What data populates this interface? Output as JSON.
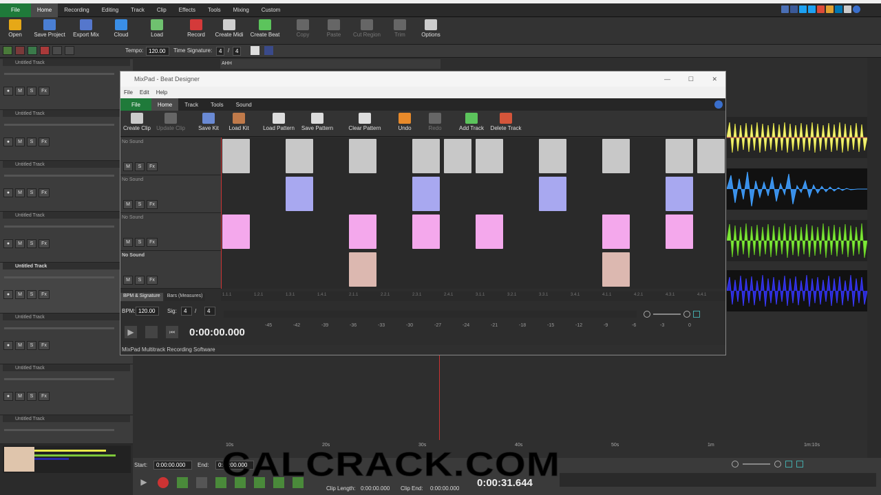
{
  "app_tabs": [
    "File",
    "Home",
    "Recording",
    "Editing",
    "Track",
    "Clip",
    "Effects",
    "Tools",
    "Mixing",
    "Custom"
  ],
  "ribbon": [
    {
      "label": "Open",
      "color": "#e6a817"
    },
    {
      "label": "Save Project",
      "color": "#4a7fd4"
    },
    {
      "label": "Export Mix",
      "color": "#5577cc"
    },
    {
      "label": "Cloud",
      "color": "#3a8ee6"
    },
    {
      "label": "Load",
      "color": "#6fc16f"
    },
    {
      "label": "Record",
      "color": "#d43a3a"
    },
    {
      "label": "Create Midi",
      "color": "#cfcfcf"
    },
    {
      "label": "Create Beat",
      "color": "#5cc45c"
    },
    {
      "label": "Copy",
      "color": "#777"
    },
    {
      "label": "Paste",
      "color": "#777"
    },
    {
      "label": "Cut Region",
      "color": "#777"
    },
    {
      "label": "Trim",
      "color": "#777"
    },
    {
      "label": "Options",
      "color": "#cccccc"
    }
  ],
  "toolrow": {
    "tempo_label": "Tempo:",
    "tempo": "120.00",
    "sig_label": "Time Signature:",
    "sig_top": "4",
    "sig_sep": "/",
    "sig_bottom": "4"
  },
  "tracks": [
    "Untitled Track",
    "Untitled Track",
    "Untitled Track",
    "Untitled Track",
    "Untitled Track",
    "Untitled Track",
    "Untitled Track",
    "Untitled Track"
  ],
  "track_buttons": [
    "M",
    "S",
    "Fx"
  ],
  "clip_label": "AHH",
  "dialog": {
    "title": "MixPad - Beat Designer",
    "menu": [
      "File",
      "Edit",
      "Help"
    ],
    "tabs": [
      "File",
      "Home",
      "Track",
      "Tools",
      "Sound"
    ],
    "ribbon": [
      "Create Clip",
      "Update Clip",
      "Save Kit",
      "Load Kit",
      "Load Pattern",
      "Save Pattern",
      "Clear Pattern",
      "Undo",
      "Redo",
      "Add Track",
      "Delete Track"
    ],
    "lanes": [
      "No Sound",
      "No Sound",
      "No Sound",
      "No Sound"
    ],
    "bpm_tab": "BPM & Signature",
    "bars_tab": "Bars (Measures)",
    "bpm_label": "BPM:",
    "bpm": "120.00",
    "sig_label": "Sig:",
    "sig_top": "4",
    "sig_sep": "/",
    "sig_bottom": "4",
    "time": "0:00:00.000",
    "status": "MixPad Multitrack Recording Software",
    "meter_ticks": [
      "-45",
      "-42",
      "-39",
      "-36",
      "-33",
      "-30",
      "-27",
      "-24",
      "-21",
      "-18",
      "-15",
      "-12",
      "-9",
      "-6",
      "-3",
      "0"
    ],
    "measure_labels": [
      "1.1.1",
      "1.2.1",
      "1.3.1",
      "1.4.1",
      "2.1.1",
      "2.2.1",
      "2.3.1",
      "2.4.1",
      "3.1.1",
      "3.2.1",
      "3.3.1",
      "3.4.1",
      "4.1.1",
      "4.2.1",
      "4.3.1",
      "4.4.1"
    ]
  },
  "timeline_labels": [
    "10s",
    "20s",
    "30s",
    "40s",
    "50s",
    "1m",
    "1m:10s"
  ],
  "bottom": {
    "start_label": "Start:",
    "start": "0:00:00.000",
    "end_label": "End:",
    "end": "0:00:00.000",
    "cliplen_label": "Clip Length:",
    "cliplen": "0:00:00.000",
    "clipend_label": "Clip End:",
    "clipend": "0:00:00.000",
    "time": "0:00:31.644"
  },
  "watermark": "CALCRACK.COM"
}
